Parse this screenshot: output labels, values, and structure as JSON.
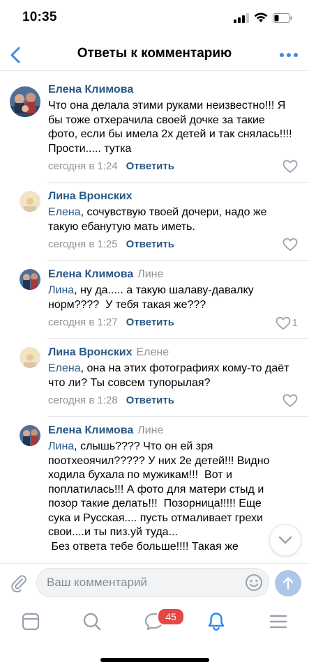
{
  "status_bar": {
    "time": "10:35"
  },
  "nav": {
    "title": "Ответы к комментарию"
  },
  "colors": {
    "accent": "#2a5885",
    "link_blue": "#4a76a8",
    "muted": "#939393",
    "badge_red": "#e64646"
  },
  "comments": [
    {
      "author": "Елена Климова",
      "reply_to": "",
      "text": "Что она делала этими руками неизвестно!!! Я бы тоже отхерачила своей дочке за такие фото, если бы имела 2х детей и так снялась!!!! Прости..... тутка",
      "time": "сегодня в 1:24",
      "reply_label": "Ответить",
      "likes": ""
    },
    {
      "author": "Лина Вронских",
      "reply_to": "",
      "mention": "Елена",
      "text": ", сочувствую твоей дочери, надо же такую ебанутую мать иметь.",
      "time": "сегодня в 1:25",
      "reply_label": "Ответить",
      "likes": ""
    },
    {
      "author": "Елена Климова",
      "reply_to": "Лине",
      "mention": "Лина",
      "text": ", ну да..... а такую шалаву-давалку норм????  У тебя такая же???",
      "time": "сегодня в 1:27",
      "reply_label": "Ответить",
      "likes": "1"
    },
    {
      "author": "Лина Вронских",
      "reply_to": "Елене",
      "mention": "Елена",
      "text": ", она на этих фотографиях кому-то даёт что ли? Ты совсем тупорылая?",
      "time": "сегодня в 1:28",
      "reply_label": "Ответить",
      "likes": ""
    },
    {
      "author": "Елена Климова",
      "reply_to": "Лине",
      "mention": "Лина",
      "text": ", слышь???? Что он ей зря поотхеоячил????? У них 2е детей!!! Видно ходила бухала по мужикам!!!  Вот и поплатилась!!! А фото для матери стыд и позор такие делать!!!  Позорница!!!!! Еще сука и Русская.... пусть отмаливает грехи свои....и ты пиз.уй туда...\n Без ответа тебе больше!!!! Такая же"
    }
  ],
  "composer": {
    "placeholder": "Ваш комментарий"
  },
  "tabbar": {
    "messages_badge": "45"
  }
}
